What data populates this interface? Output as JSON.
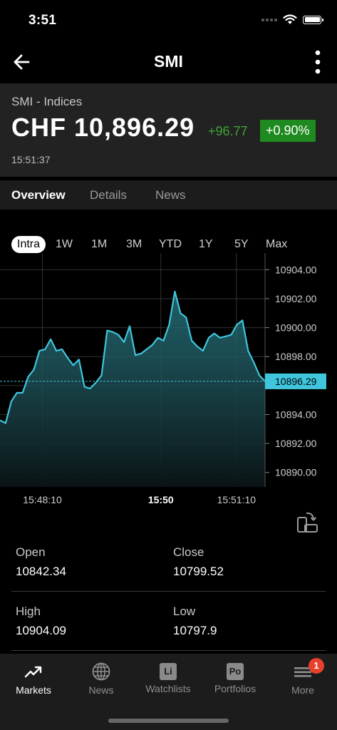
{
  "status_bar": {
    "time": "3:51"
  },
  "nav": {
    "title": "SMI"
  },
  "quote": {
    "subtitle": "SMI - Indices",
    "price": "CHF 10,896.29",
    "change": "+96.77",
    "change_pct": "+0.90%",
    "time": "15:51:37",
    "positive_color": "#3da337"
  },
  "tabs": [
    {
      "label": "Overview",
      "active": true
    },
    {
      "label": "Details",
      "active": false
    },
    {
      "label": "News",
      "active": false
    }
  ],
  "ranges": [
    {
      "label": "Intra",
      "active": true
    },
    {
      "label": "1W"
    },
    {
      "label": "1M"
    },
    {
      "label": "3M"
    },
    {
      "label": "YTD"
    },
    {
      "label": "1Y"
    },
    {
      "label": "5Y"
    },
    {
      "label": "Max"
    }
  ],
  "chart_data": {
    "type": "area",
    "line_color": "#3fc6dc",
    "ylim": [
      10889,
      10905
    ],
    "y_ticks": [
      "10904.00",
      "10902.00",
      "10900.00",
      "10898.00",
      "10896.00",
      "10894.00",
      "10892.00",
      "10890.00"
    ],
    "x_ticks": [
      {
        "label": "15:48:10",
        "bold": false
      },
      {
        "label": "15:50",
        "bold": true
      },
      {
        "label": "15:51:10",
        "bold": false
      }
    ],
    "current_value": "10896.29",
    "values": [
      10893.6,
      10893.4,
      10894.9,
      10895.5,
      10895.5,
      10896.6,
      10897.1,
      10898.4,
      10898.5,
      10899.2,
      10898.4,
      10898.5,
      10897.9,
      10897.4,
      10897.8,
      10895.9,
      10895.8,
      10896.2,
      10896.7,
      10899.8,
      10899.7,
      10899.5,
      10899.0,
      10900.1,
      10898.1,
      10898.2,
      10898.5,
      10898.8,
      10899.3,
      10899.1,
      10900.2,
      10902.5,
      10901.0,
      10900.7,
      10899.1,
      10898.7,
      10898.4,
      10899.3,
      10899.6,
      10899.3,
      10899.4,
      10899.5,
      10900.2,
      10900.5,
      10898.4,
      10897.6,
      10896.7,
      10896.29
    ]
  },
  "stats": [
    {
      "label": "Open",
      "value": "10842.34"
    },
    {
      "label": "Close",
      "value": "10799.52"
    },
    {
      "label": "High",
      "value": "10904.09"
    },
    {
      "label": "Low",
      "value": "10797.9"
    }
  ],
  "tabbar": [
    {
      "label": "Markets",
      "icon": "trend-up-icon",
      "active": true
    },
    {
      "label": "News",
      "icon": "globe-icon"
    },
    {
      "label": "Watchlists",
      "icon": "Li"
    },
    {
      "label": "Portfolios",
      "icon": "Po"
    },
    {
      "label": "More",
      "icon": "hamburger-icon",
      "badge": "1"
    }
  ]
}
